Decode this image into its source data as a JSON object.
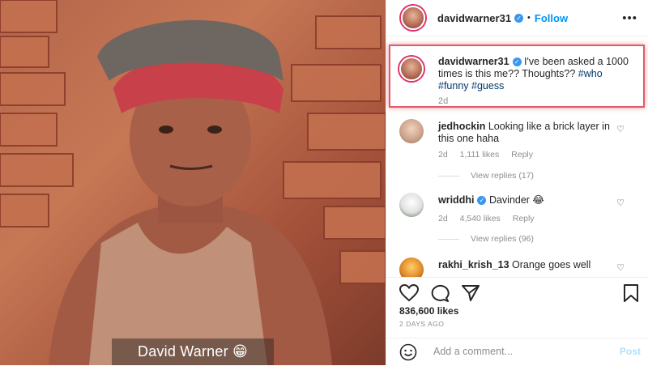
{
  "photo": {
    "caption": "David Warner 😁"
  },
  "post": {
    "username": "davidwarner31",
    "follow_label": "Follow",
    "more_icon": "more-options-icon",
    "caption_prefix": "I've been asked a 1000 times is this me?? Thoughts??",
    "hashtags": [
      "#who",
      "#funny",
      "#guess"
    ],
    "caption_time": "2d",
    "likes": "836,600 likes",
    "posted": "2 DAYS AGO"
  },
  "comments": [
    {
      "username": "jedhockin",
      "verified": false,
      "text": "Looking like a brick layer in this one haha",
      "time": "2d",
      "likes": "1,111 likes",
      "reply": "Reply",
      "view_replies": "View replies (17)"
    },
    {
      "username": "wriddhi",
      "verified": true,
      "text": "Davinder 😂",
      "time": "2d",
      "likes": "4,540 likes",
      "reply": "Reply",
      "view_replies": "View replies (96)"
    },
    {
      "username": "rakhi_krish_13",
      "verified": false,
      "text": "Orange goes well"
    }
  ],
  "add_comment": {
    "placeholder": "Add a comment...",
    "post_label": "Post"
  },
  "colors": {
    "accent": "#0095f6",
    "highlight_border": "#e05a6a",
    "verified": "#3897f0"
  }
}
